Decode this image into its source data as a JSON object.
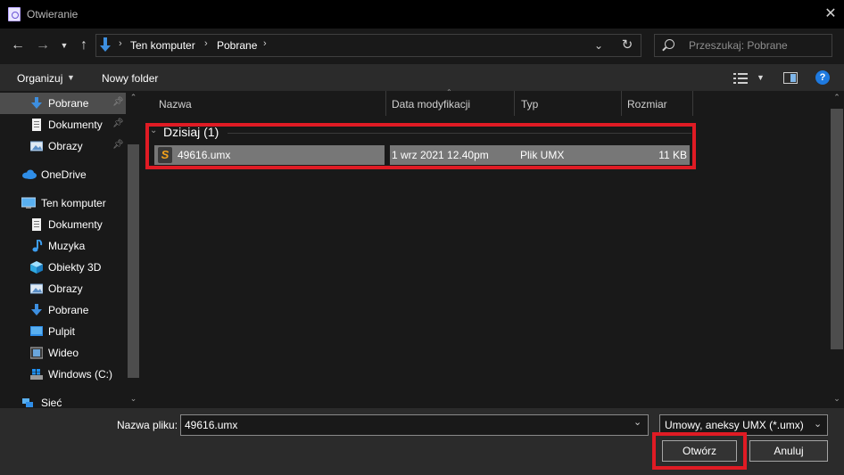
{
  "window": {
    "title": "Otwieranie"
  },
  "address": {
    "crumbs": [
      "Ten komputer",
      "Pobrane"
    ],
    "separator": "›"
  },
  "search": {
    "placeholder": "Przeszukaj: Pobrane"
  },
  "toolbar": {
    "organize": "Organizuj",
    "new_folder": "Nowy folder"
  },
  "sidebar": {
    "items": [
      {
        "label": "Pobrane",
        "icon": "download-arrow-icon",
        "pinned": true,
        "selected": true
      },
      {
        "label": "Dokumenty",
        "icon": "document-icon",
        "pinned": true
      },
      {
        "label": "Obrazy",
        "icon": "pictures-icon",
        "pinned": true
      },
      {
        "label": "OneDrive",
        "icon": "cloud-icon"
      },
      {
        "label": "Ten komputer",
        "icon": "computer-icon"
      },
      {
        "label": "Dokumenty",
        "icon": "document-icon"
      },
      {
        "label": "Muzyka",
        "icon": "music-note-icon"
      },
      {
        "label": "Obiekty 3D",
        "icon": "cube-icon"
      },
      {
        "label": "Obrazy",
        "icon": "pictures-icon"
      },
      {
        "label": "Pobrane",
        "icon": "download-arrow-icon"
      },
      {
        "label": "Pulpit",
        "icon": "desktop-icon"
      },
      {
        "label": "Wideo",
        "icon": "video-icon"
      },
      {
        "label": "Windows (C:)",
        "icon": "drive-icon"
      },
      {
        "label": "Sieć",
        "icon": "network-icon"
      }
    ]
  },
  "columns": {
    "name": "Nazwa",
    "date": "Data modyfikacji",
    "type": "Typ",
    "size": "Rozmiar"
  },
  "group": {
    "label": "Dzisiaj (1)"
  },
  "files": [
    {
      "name": "49616.umx",
      "date": "1 wrz 2021 12.40pm",
      "type": "Plik UMX",
      "size": "11 KB",
      "icon": "sublime-file-icon"
    }
  ],
  "bottom": {
    "filename_label": "Nazwa pliku:",
    "filename_value": "49616.umx",
    "filter": "Umowy, aneksy UMX (*.umx)",
    "open": "Otwórz",
    "cancel": "Anuluj"
  },
  "colors": {
    "highlight": "#e01b24",
    "accent": "#1e7ae0"
  }
}
